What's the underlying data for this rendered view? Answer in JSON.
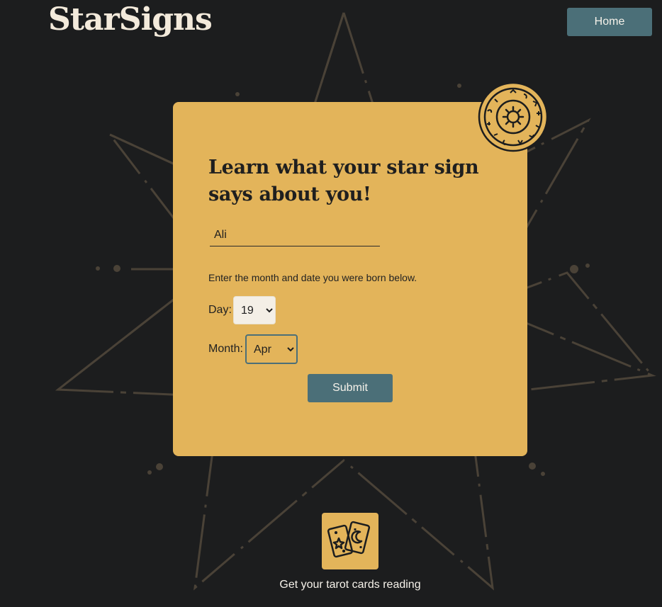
{
  "header": {
    "logo": "StarSigns",
    "home_label": "Home"
  },
  "form": {
    "heading": "Learn what your star sign says about you!",
    "name_value": "Ali",
    "instruction": "Enter the month and date you were born below.",
    "day_label": "Day:",
    "day_value": "19",
    "month_label": "Month:",
    "month_value": "Apr",
    "submit_label": "Submit"
  },
  "footer": {
    "tarot_label": "Get your tarot cards reading"
  },
  "icons": {
    "zodiac": "zodiac-wheel-icon",
    "tarot": "tarot-cards-icon"
  },
  "colors": {
    "background": "#1c1d1e",
    "card": "#e3b45a",
    "button": "#4b6f78",
    "star_lines": "#4a4237"
  }
}
